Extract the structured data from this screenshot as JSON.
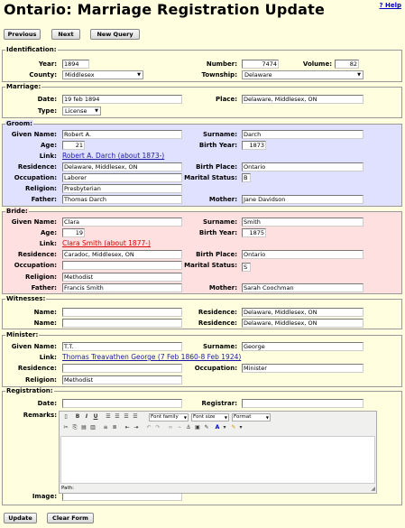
{
  "page": {
    "title": "Ontario: Marriage Registration Update",
    "help": "? Help"
  },
  "nav": {
    "previous": "Previous",
    "next": "Next",
    "new_query": "New Query"
  },
  "identification": {
    "legend": "Identification:",
    "year_label": "Year:",
    "year": "1894",
    "number_label": "Number:",
    "number": "7474",
    "volume_label": "Volume:",
    "volume": "82",
    "county_label": "County:",
    "county": "Middlesex",
    "township_label": "Township:",
    "township": "Delaware"
  },
  "marriage": {
    "legend": "Marriage:",
    "date_label": "Date:",
    "date": "19 feb 1894",
    "place_label": "Place:",
    "place": "Delaware, Middlesex, ON",
    "type_label": "Type:",
    "type": "License"
  },
  "groom": {
    "legend": "Groom:",
    "given_label": "Given Name:",
    "given": "Robert A.",
    "surname_label": "Surname:",
    "surname": "Darch",
    "age_label": "Age:",
    "age": "21",
    "birth_year_label": "Birth Year:",
    "birth_year": "1873",
    "link_label": "Link:",
    "link": "Robert A. Darch (about 1873-)",
    "residence_label": "Residence:",
    "residence": "Delaware, Middlesex, ON",
    "birth_place_label": "Birth Place:",
    "birth_place": "Ontario",
    "occupation_label": "Occupation:",
    "occupation": "Laborer",
    "marital_label": "Marital Status:",
    "marital": "B",
    "religion_label": "Religion:",
    "religion": "Presbyterian",
    "father_label": "Father:",
    "father": "Thomas Darch",
    "mother_label": "Mother:",
    "mother": "Jane Davidson"
  },
  "bride": {
    "legend": "Bride:",
    "given_label": "Given Name:",
    "given": "Clara",
    "surname_label": "Surname:",
    "surname": "Smith",
    "age_label": "Age:",
    "age": "19",
    "birth_year_label": "Birth Year:",
    "birth_year": "1875",
    "link_label": "Link:",
    "link": "Clara Smith (about 1877-)",
    "residence_label": "Residence:",
    "residence": "Caradoc, Middlesex, ON",
    "birth_place_label": "Birth Place:",
    "birth_place": "Ontario",
    "occupation_label": "Occupation:",
    "occupation": "",
    "marital_label": "Marital Status:",
    "marital": "S",
    "religion_label": "Religion:",
    "religion": "Methodist",
    "father_label": "Father:",
    "father": "Francis Smith",
    "mother_label": "Mother:",
    "mother": "Sarah Coochman"
  },
  "witnesses": {
    "legend": "Witnesses:",
    "name_label": "Name:",
    "residence_label": "Residence:",
    "w1_name": "",
    "w1_residence": "Delaware, Middlesex, ON",
    "w2_name": "",
    "w2_residence": "Delaware, Middlesex, ON"
  },
  "minister": {
    "legend": "Minister:",
    "given_label": "Given Name:",
    "given": "T.T.",
    "surname_label": "Surname:",
    "surname": "George",
    "link_label": "Link:",
    "link": "Thomas Treavathen George (7 Feb 1860-8 Feb 1924)",
    "residence_label": "Residence:",
    "residence": "",
    "occupation_label": "Occupation:",
    "occupation": "Minister",
    "religion_label": "Religion:",
    "religion": "Methodist"
  },
  "registration": {
    "legend": "Registration:",
    "date_label": "Date:",
    "date": "",
    "registrar_label": "Registrar:",
    "registrar": "",
    "remarks_label": "Remarks:",
    "image_label": "Image:",
    "image": "",
    "editor": {
      "font_family": "Font family",
      "font_size": "Font size",
      "format": "Format",
      "path": "Path:"
    }
  },
  "actions": {
    "update": "Update",
    "clear": "Clear Form"
  },
  "colors": {
    "page_bg": "#ffffe0",
    "groom_bg": "#e0e0ff",
    "bride_bg": "#ffe0e0",
    "link": "#1a1aa6",
    "bride_link": "#dd0000"
  }
}
